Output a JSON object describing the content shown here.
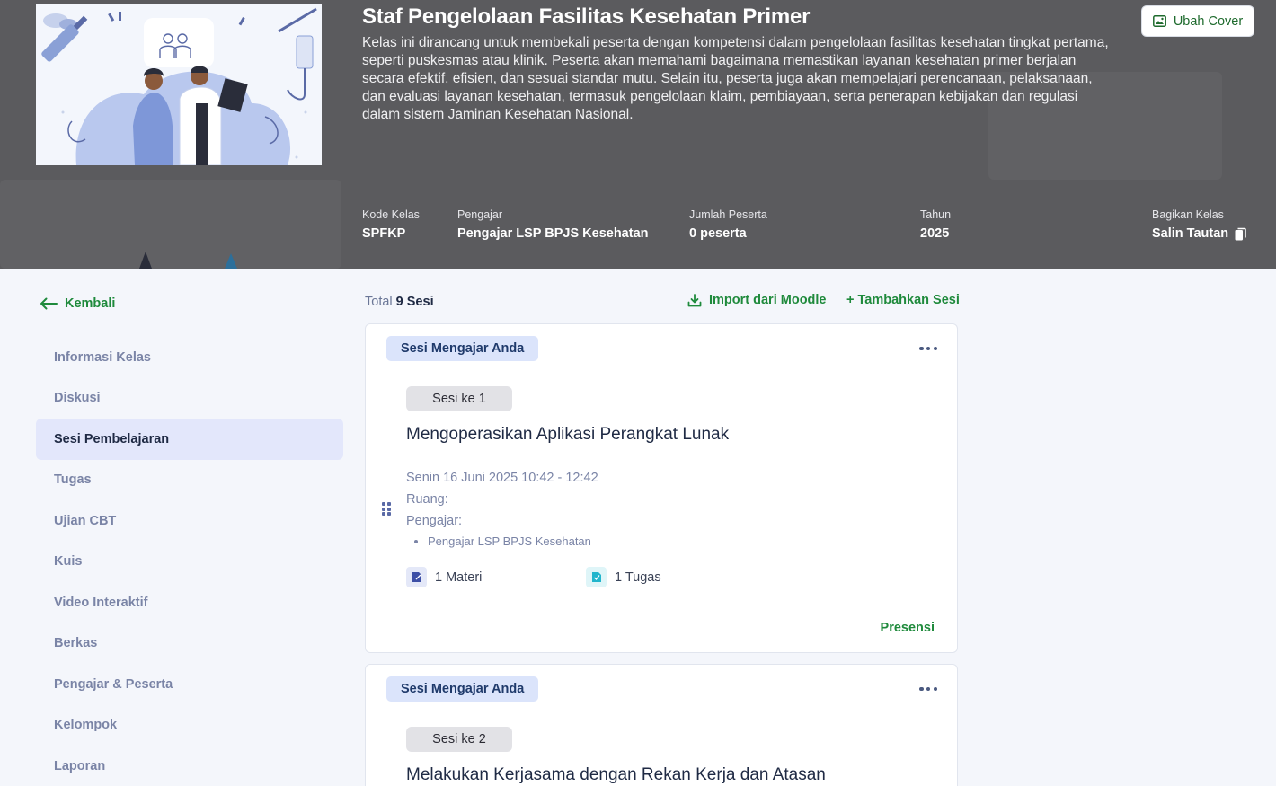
{
  "header": {
    "title": "Staf Pengelolaan Fasilitas Kesehatan Primer",
    "description": "Kelas ini dirancang untuk membekali peserta dengan kompetensi dalam pengelolaan fasilitas kesehatan tingkat pertama, seperti puskesmas atau klinik. Peserta akan memahami bagaimana memastikan layanan kesehatan primer berjalan secara efektif, efisien, dan sesuai standar mutu. Selain itu, peserta juga akan mempelajari perencanaan, pelaksanaan, dan evaluasi layanan kesehatan, termasuk pengelolaan klaim, pembiayaan, serta penerapan kebijakan dan regulasi dalam sistem Jaminan Kesehatan Nasional.",
    "cover_button": "Ubah Cover",
    "meta": [
      {
        "label": "Kode Kelas",
        "value": "SPFKP"
      },
      {
        "label": "Pengajar",
        "value": "Pengajar LSP BPJS Kesehatan"
      },
      {
        "label": "Jumlah Peserta",
        "value": "0 peserta"
      },
      {
        "label": "Tahun",
        "value": "2025"
      },
      {
        "label": "Bagikan Kelas",
        "value": "Salin Tautan"
      }
    ]
  },
  "sidebar": {
    "back_label": "Kembali",
    "items": [
      {
        "label": "Informasi Kelas"
      },
      {
        "label": "Diskusi"
      },
      {
        "label": "Sesi Pembelajaran",
        "active": true
      },
      {
        "label": "Tugas"
      },
      {
        "label": "Ujian CBT"
      },
      {
        "label": "Kuis"
      },
      {
        "label": "Video Interaktif"
      },
      {
        "label": "Berkas"
      },
      {
        "label": "Pengajar & Peserta"
      },
      {
        "label": "Kelompok"
      },
      {
        "label": "Laporan"
      }
    ]
  },
  "main": {
    "total_label": "Total",
    "total_value": "9 Sesi",
    "import_label": "Import dari Moodle",
    "add_label": "+ Tambahkan Sesi",
    "sessions": [
      {
        "badge": "Sesi Mengajar Anda",
        "number": "Sesi ke 1",
        "title": "Mengoperasikan Aplikasi Perangkat Lunak",
        "date": "Senin 16 Juni 2025 10:42 - 12:42",
        "room_label": "Ruang:",
        "teacher_label": "Pengajar:",
        "teachers": [
          "Pengajar LSP BPJS Kesehatan"
        ],
        "materi": "1 Materi",
        "tugas": "1 Tugas",
        "presensi": "Presensi"
      },
      {
        "badge": "Sesi Mengajar Anda",
        "number": "Sesi ke 2",
        "title": "Melakukan Kerjasama dengan Rekan Kerja dan Atasan"
      }
    ]
  },
  "colors": {
    "accent_green": "#1f8a3c",
    "header_bg": "#5b5b5e",
    "active_nav_bg": "#e3e7fb",
    "badge_bg": "#dbe4fb"
  }
}
